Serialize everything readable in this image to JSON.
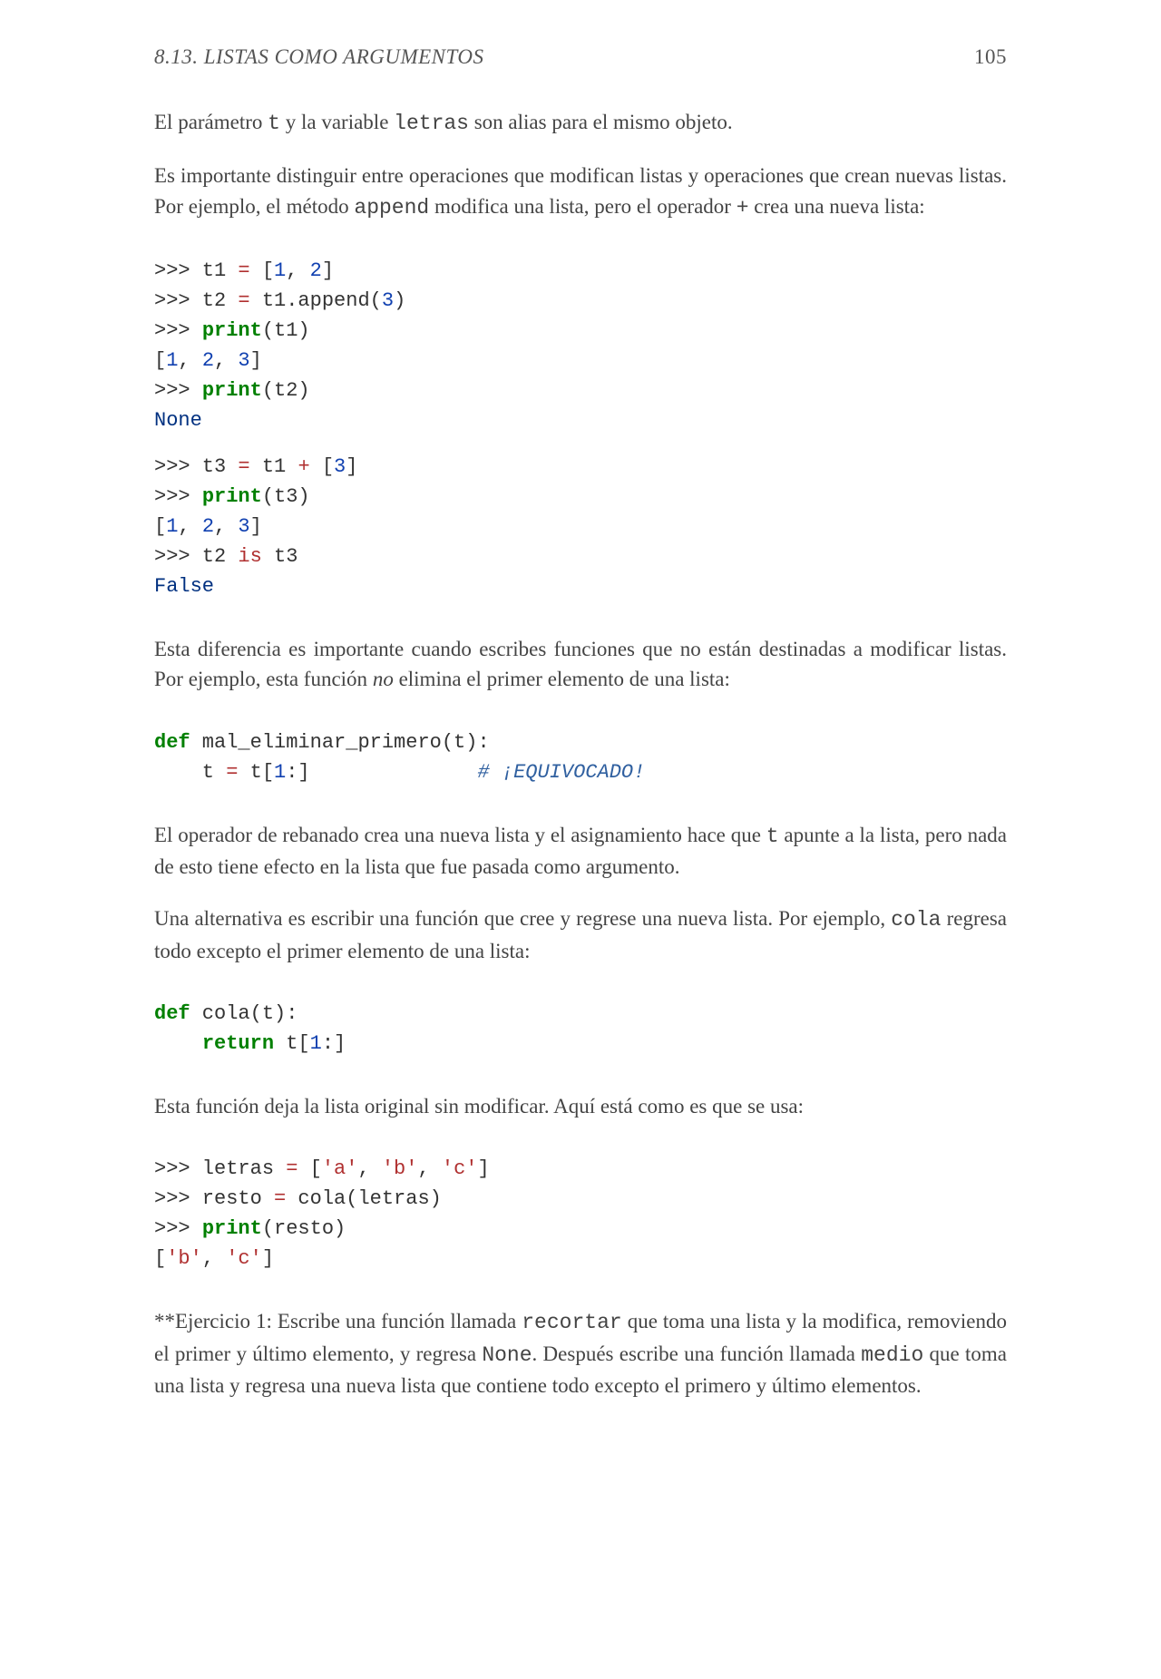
{
  "header": {
    "section": "8.13.  LISTAS COMO ARGUMENTOS",
    "page": "105"
  },
  "para1": {
    "pre": "El parámetro ",
    "code1": "t",
    "mid": " y la variable ",
    "code2": "letras",
    "post": " son alias para el mismo objeto."
  },
  "para2": {
    "pre": "Es importante distinguir entre operaciones que modifican listas y operaciones que crean nuevas listas. Por ejemplo, el método ",
    "code1": "append",
    "mid": " modifica una lista, pero el operador ",
    "code2": "+",
    "post": " crea una nueva lista:"
  },
  "code1": {
    "l1a": ">>> t1 ",
    "l1b": "=",
    "l1c": " [",
    "l1d": "1",
    "l1e": ", ",
    "l1f": "2",
    "l1g": "]",
    "l2a": ">>> t2 ",
    "l2b": "=",
    "l2c": " t1.append(",
    "l2d": "3",
    "l2e": ")",
    "l3a": ">>> ",
    "l3b": "print",
    "l3c": "(t1)",
    "l4a": "[",
    "l4b": "1",
    "l4c": ", ",
    "l4d": "2",
    "l4e": ", ",
    "l4f": "3",
    "l4g": "]",
    "l5a": ">>> ",
    "l5b": "print",
    "l5c": "(t2)",
    "l6": "None",
    "l7a": ">>> t3 ",
    "l7b": "=",
    "l7c": " t1 ",
    "l7d": "+",
    "l7e": " [",
    "l7f": "3",
    "l7g": "]",
    "l8a": ">>> ",
    "l8b": "print",
    "l8c": "(t3)",
    "l9a": "[",
    "l9b": "1",
    "l9c": ", ",
    "l9d": "2",
    "l9e": ", ",
    "l9f": "3",
    "l9g": "]",
    "l10a": ">>> t2 ",
    "l10b": "is",
    "l10c": " t3",
    "l11": "False"
  },
  "para3": {
    "pre": "Esta diferencia es importante cuando escribes funciones que no están destinadas a modificar listas. Por ejemplo, esta función ",
    "em": "no",
    "post": " elimina el primer elemento de una lista:"
  },
  "code2": {
    "l1a": "def",
    "l1b": " mal_eliminar_primero(t):",
    "l2a": "    t ",
    "l2b": "=",
    "l2c": " t[",
    "l2d": "1",
    "l2e": ":]              ",
    "l2f": "# ¡EQUIVOCADO!"
  },
  "para4": {
    "pre": "El operador de rebanado crea una nueva lista y el asignamiento hace que ",
    "code1": "t",
    "post": " apunte a la lista, pero nada de esto tiene efecto en la lista que fue pasada como argumento."
  },
  "para5": {
    "pre": "Una alternativa es escribir una función que cree y regrese una nueva lista. Por ejemplo, ",
    "code1": "cola",
    "post": " regresa todo excepto el primer elemento de una lista:"
  },
  "code3": {
    "l1a": "def",
    "l1b": " cola(t):",
    "l2a": "    ",
    "l2b": "return",
    "l2c": " t[",
    "l2d": "1",
    "l2e": ":]"
  },
  "para6": "Esta función deja la lista original sin modificar. Aquí está como es que se usa:",
  "code4": {
    "l1a": ">>> letras ",
    "l1b": "=",
    "l1c": " [",
    "l1d": "'a'",
    "l1e": ", ",
    "l1f": "'b'",
    "l1g": ", ",
    "l1h": "'c'",
    "l1i": "]",
    "l2a": ">>> resto ",
    "l2b": "=",
    "l2c": " cola(letras)",
    "l3a": ">>> ",
    "l3b": "print",
    "l3c": "(resto)",
    "l4a": "[",
    "l4b": "'b'",
    "l4c": ", ",
    "l4d": "'c'",
    "l4e": "]"
  },
  "para7": {
    "pre": "**Ejercicio 1: Escribe una función llamada ",
    "code1": "recortar",
    "mid1": " que toma una lista y la modifica, removiendo el primer y último elemento, y regresa ",
    "code2": "None",
    "mid2": ". Después escribe una función llamada ",
    "code3": "medio",
    "post": " que toma una lista y regresa una nueva lista que contiene todo excepto el primero y último elementos."
  }
}
